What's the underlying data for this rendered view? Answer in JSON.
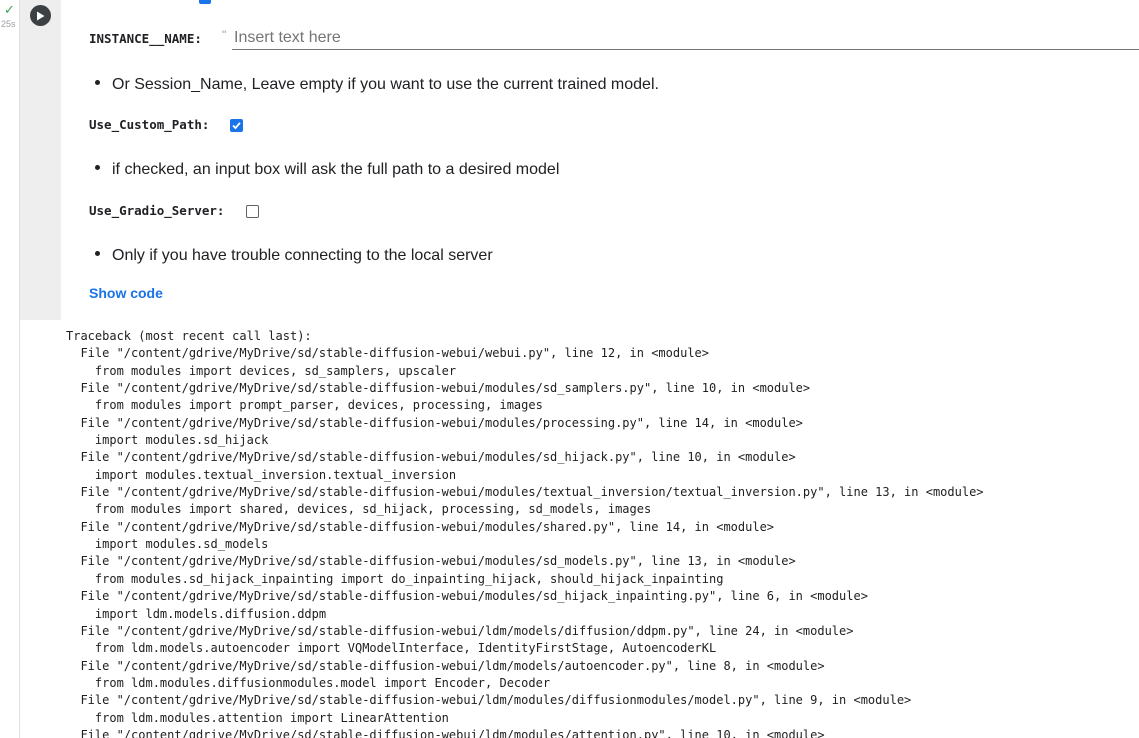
{
  "gutter": {
    "status_icon": "check-icon",
    "exec_time": "25s"
  },
  "form": {
    "instance_name": {
      "label": "INSTANCE__NAME:",
      "quote": "\"",
      "placeholder": "Insert text here",
      "value": ""
    },
    "instance_hint": "Or Session_Name, Leave empty if you want to use the current trained model.",
    "use_custom_path": {
      "label": "Use_Custom_Path:",
      "checked": true
    },
    "custom_path_hint": "if checked, an input box will ask the full path to a desired model",
    "use_gradio_server": {
      "label": "Use_Gradio_Server:",
      "checked": false
    },
    "gradio_hint": "Only if you have trouble connecting to the local server",
    "show_code_label": "Show code"
  },
  "colors": {
    "accent": "#1a73e8",
    "success": "#34a853",
    "cell_gray": "#eeeeee"
  },
  "output": {
    "traceback": [
      "Traceback (most recent call last):",
      "  File \"/content/gdrive/MyDrive/sd/stable-diffusion-webui/webui.py\", line 12, in <module>",
      "    from modules import devices, sd_samplers, upscaler",
      "  File \"/content/gdrive/MyDrive/sd/stable-diffusion-webui/modules/sd_samplers.py\", line 10, in <module>",
      "    from modules import prompt_parser, devices, processing, images",
      "  File \"/content/gdrive/MyDrive/sd/stable-diffusion-webui/modules/processing.py\", line 14, in <module>",
      "    import modules.sd_hijack",
      "  File \"/content/gdrive/MyDrive/sd/stable-diffusion-webui/modules/sd_hijack.py\", line 10, in <module>",
      "    import modules.textual_inversion.textual_inversion",
      "  File \"/content/gdrive/MyDrive/sd/stable-diffusion-webui/modules/textual_inversion/textual_inversion.py\", line 13, in <module>",
      "    from modules import shared, devices, sd_hijack, processing, sd_models, images",
      "  File \"/content/gdrive/MyDrive/sd/stable-diffusion-webui/modules/shared.py\", line 14, in <module>",
      "    import modules.sd_models",
      "  File \"/content/gdrive/MyDrive/sd/stable-diffusion-webui/modules/sd_models.py\", line 13, in <module>",
      "    from modules.sd_hijack_inpainting import do_inpainting_hijack, should_hijack_inpainting",
      "  File \"/content/gdrive/MyDrive/sd/stable-diffusion-webui/modules/sd_hijack_inpainting.py\", line 6, in <module>",
      "    import ldm.models.diffusion.ddpm",
      "  File \"/content/gdrive/MyDrive/sd/stable-diffusion-webui/ldm/models/diffusion/ddpm.py\", line 24, in <module>",
      "    from ldm.models.autoencoder import VQModelInterface, IdentityFirstStage, AutoencoderKL",
      "  File \"/content/gdrive/MyDrive/sd/stable-diffusion-webui/ldm/models/autoencoder.py\", line 8, in <module>",
      "    from ldm.modules.diffusionmodules.model import Encoder, Decoder",
      "  File \"/content/gdrive/MyDrive/sd/stable-diffusion-webui/ldm/modules/diffusionmodules/model.py\", line 9, in <module>",
      "    from ldm.modules.attention import LinearAttention",
      "  File \"/content/gdrive/MyDrive/sd/stable-diffusion-webui/ldm/modules/attention.py\", line 10, in <module>"
    ]
  }
}
